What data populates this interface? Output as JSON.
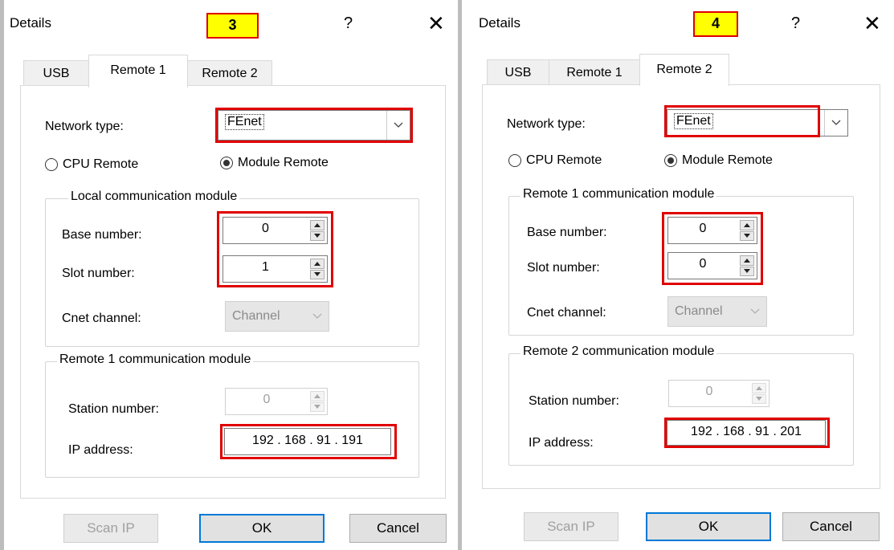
{
  "dialogs": [
    {
      "title": "Details",
      "badge": "3",
      "help_glyph": "?",
      "close_glyph": "✕",
      "tabs": [
        {
          "label": "USB",
          "active": false
        },
        {
          "label": "Remote 1",
          "active": true
        },
        {
          "label": "Remote 2",
          "active": false
        }
      ],
      "network_type_label": "Network type:",
      "network_type_value": "FEnet",
      "radio_cpu": "CPU Remote",
      "radio_module": "Module Remote",
      "radio_selected": "Module Remote",
      "group1_title": "Local communication module",
      "base_label": "Base number:",
      "base_value": "0",
      "slot_label": "Slot number:",
      "slot_value": "1",
      "cnet_label": "Cnet channel:",
      "cnet_value": "Channel",
      "group2_title": "Remote 1 communication module",
      "station_label": "Station number:",
      "station_value": "0",
      "ip_label": "IP address:",
      "ip_value": "192 . 168 .  91  . 191",
      "scan_button": "Scan IP",
      "ok_button": "OK",
      "cancel_button": "Cancel"
    },
    {
      "title": "Details",
      "badge": "4",
      "help_glyph": "?",
      "close_glyph": "✕",
      "tabs": [
        {
          "label": "USB",
          "active": false
        },
        {
          "label": "Remote 1",
          "active": false
        },
        {
          "label": "Remote 2",
          "active": true
        }
      ],
      "network_type_label": "Network type:",
      "network_type_value": "FEnet",
      "radio_cpu": "CPU Remote",
      "radio_module": "Module Remote",
      "radio_selected": "Module Remote",
      "group1_title": "Remote 1 communication module",
      "base_label": "Base number:",
      "base_value": "0",
      "slot_label": "Slot number:",
      "slot_value": "0",
      "cnet_label": "Cnet channel:",
      "cnet_value": "Channel",
      "group2_title": "Remote 2 communication module",
      "station_label": "Station number:",
      "station_value": "0",
      "ip_label": "IP address:",
      "ip_value": "192 . 168 .  91  . 201",
      "scan_button": "Scan IP",
      "ok_button": "OK",
      "cancel_button": "Cancel"
    }
  ],
  "colors": {
    "highlight_border": "#e00000",
    "badge_fill": "#ffff00",
    "default_button_border": "#0078d7"
  },
  "icons": [
    "help-icon",
    "close-icon",
    "chevron-down-icon",
    "spin-up-icon",
    "spin-down-icon"
  ]
}
